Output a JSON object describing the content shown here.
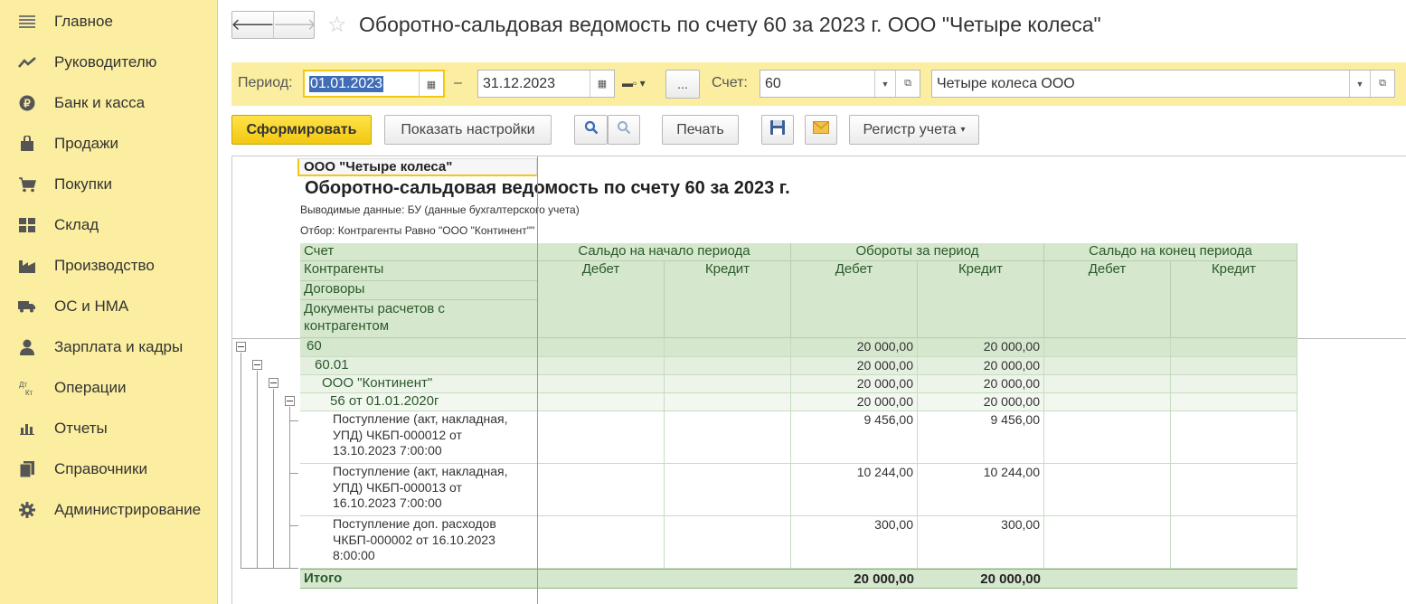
{
  "sidebar": {
    "items": [
      {
        "label": "Главное",
        "icon": "menu-lines-icon"
      },
      {
        "label": "Руководителю",
        "icon": "trend-chart-icon"
      },
      {
        "label": "Банк и касса",
        "icon": "ruble-coin-icon"
      },
      {
        "label": "Продажи",
        "icon": "shopping-bag-icon"
      },
      {
        "label": "Покупки",
        "icon": "cart-icon"
      },
      {
        "label": "Склад",
        "icon": "warehouse-icon"
      },
      {
        "label": "Производство",
        "icon": "factory-icon"
      },
      {
        "label": "ОС и НМА",
        "icon": "truck-icon"
      },
      {
        "label": "Зарплата и кадры",
        "icon": "person-icon"
      },
      {
        "label": "Операции",
        "icon": "dt-kt-icon"
      },
      {
        "label": "Отчеты",
        "icon": "bar-chart-icon"
      },
      {
        "label": "Справочники",
        "icon": "books-icon"
      },
      {
        "label": "Администрирование",
        "icon": "gear-icon"
      }
    ]
  },
  "header": {
    "title": "Оборотно-сальдовая ведомость по счету 60 за 2023 г. ООО \"Четыре колеса\""
  },
  "filters": {
    "period_label": "Период:",
    "date_from": "01.01.2023",
    "dash": "–",
    "date_to": "31.12.2023",
    "more": "...",
    "account_label": "Счет:",
    "account_value": "60",
    "org_value": "Четыре колеса ООО"
  },
  "toolbar": {
    "generate": "Сформировать",
    "show_settings": "Показать настройки",
    "print": "Печать",
    "register": "Регистр учета"
  },
  "report": {
    "org": "ООО \"Четыре колеса\"",
    "title": "Оборотно-сальдовая ведомость по счету 60 за 2023 г.",
    "output_data": "Выводимые данные: БУ (данные бухгалтерского учета)",
    "filter": "Отбор: Контрагенты Равно \"ООО \"Континент\"\"",
    "headers": {
      "account": "Счет",
      "counterparties": "Контрагенты",
      "contracts": "Договоры",
      "documents": "Документы расчетов с\nконтрагентом",
      "opening": "Сальдо на начало периода",
      "turnover": "Обороты за период",
      "closing": "Сальдо на конец периода",
      "debit": "Дебет",
      "credit": "Кредит"
    },
    "rows": [
      {
        "label": "60",
        "turn_debit": "20 000,00",
        "turn_credit": "20 000,00"
      },
      {
        "label": "60.01",
        "turn_debit": "20 000,00",
        "turn_credit": "20 000,00"
      },
      {
        "label": "ООО \"Континент\"",
        "turn_debit": "20 000,00",
        "turn_credit": "20 000,00"
      },
      {
        "label": "56 от 01.01.2020г",
        "turn_debit": "20 000,00",
        "turn_credit": "20 000,00"
      },
      {
        "label": "Поступление (акт, накладная,\nУПД) ЧКБП-000012 от\n13.10.2023 7:00:00",
        "turn_debit": "9 456,00",
        "turn_credit": "9 456,00"
      },
      {
        "label": "Поступление (акт, накладная,\nУПД) ЧКБП-000013 от\n16.10.2023 7:00:00",
        "turn_debit": "10 244,00",
        "turn_credit": "10 244,00"
      },
      {
        "label": "Поступление доп. расходов\nЧКБП-000002 от 16.10.2023\n8:00:00",
        "turn_debit": "300,00",
        "turn_credit": "300,00"
      }
    ],
    "total": {
      "label": "Итого",
      "turn_debit": "20 000,00",
      "turn_credit": "20 000,00"
    }
  }
}
